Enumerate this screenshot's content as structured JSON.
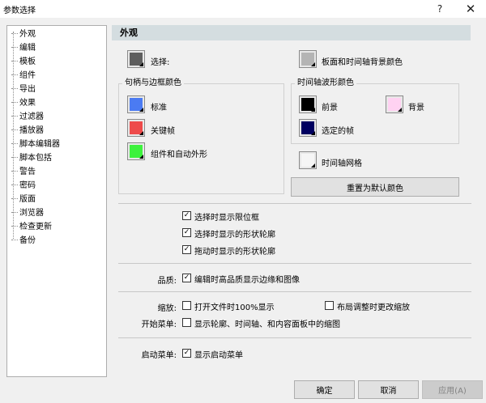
{
  "window": {
    "title": "参数选择",
    "help": "?",
    "close": "✕"
  },
  "sidebar": {
    "items": [
      {
        "label": "外观"
      },
      {
        "label": "编辑"
      },
      {
        "label": "模板"
      },
      {
        "label": "组件"
      },
      {
        "label": "导出"
      },
      {
        "label": "效果"
      },
      {
        "label": "过滤器"
      },
      {
        "label": "播放器"
      },
      {
        "label": "脚本编辑器"
      },
      {
        "label": "脚本包括"
      },
      {
        "label": "警告"
      },
      {
        "label": "密码"
      },
      {
        "label": "版面"
      },
      {
        "label": "浏览器"
      },
      {
        "label": "检查更新"
      },
      {
        "label": "备份"
      }
    ]
  },
  "appearance": {
    "header": "外观",
    "selection": {
      "label": "选择:",
      "color": "#5e5e5e"
    },
    "board_bg": {
      "label": "板面和时间轴背景颜色",
      "color": "#b4b4b4"
    },
    "handle_group": {
      "title": "句柄与边框颜色",
      "items": [
        {
          "label": "标准",
          "color": "#4b7bf2"
        },
        {
          "label": "关键帧",
          "color": "#ee4a4a"
        },
        {
          "label": "组件和自动外形",
          "color": "#3df23d"
        }
      ]
    },
    "wave_group": {
      "title": "时间轴波形颜色",
      "foreground": {
        "label": "前景",
        "color": "#000000"
      },
      "background": {
        "label": "背景",
        "color": "#ffd2f2"
      },
      "selected": {
        "label": "选定的帧",
        "color": "#000060"
      }
    },
    "grid": {
      "label": "时间轴网格",
      "color": "#f5f5f5"
    },
    "reset_button": "重置为默认颜色",
    "checks": {
      "show_bounds": {
        "label": "选择时显示限位框",
        "checked": true
      },
      "show_outline": {
        "label": "选择时显示的形状轮廓",
        "checked": true
      },
      "drag_outline": {
        "label": "拖动时显示的形状轮廓",
        "checked": true
      }
    },
    "quality": {
      "label": "品质:",
      "check": {
        "label": "编辑时高品质显示边缘和图像",
        "checked": true
      }
    },
    "zoom": {
      "label": "缩放:",
      "open_100": {
        "label": "打开文件时100%显示",
        "checked": false
      },
      "layout_zoom": {
        "label": "布局调整时更改缩放",
        "checked": false
      }
    },
    "start_menu": {
      "label": "开始菜单:",
      "check": {
        "label": "显示轮廓、时间轴、和内容面板中的缩图",
        "checked": false
      }
    },
    "launch_menu": {
      "label": "启动菜单:",
      "check": {
        "label": "显示启动菜单",
        "checked": true
      }
    }
  },
  "footer": {
    "ok": "确定",
    "cancel": "取消",
    "apply": "应用(A)"
  }
}
